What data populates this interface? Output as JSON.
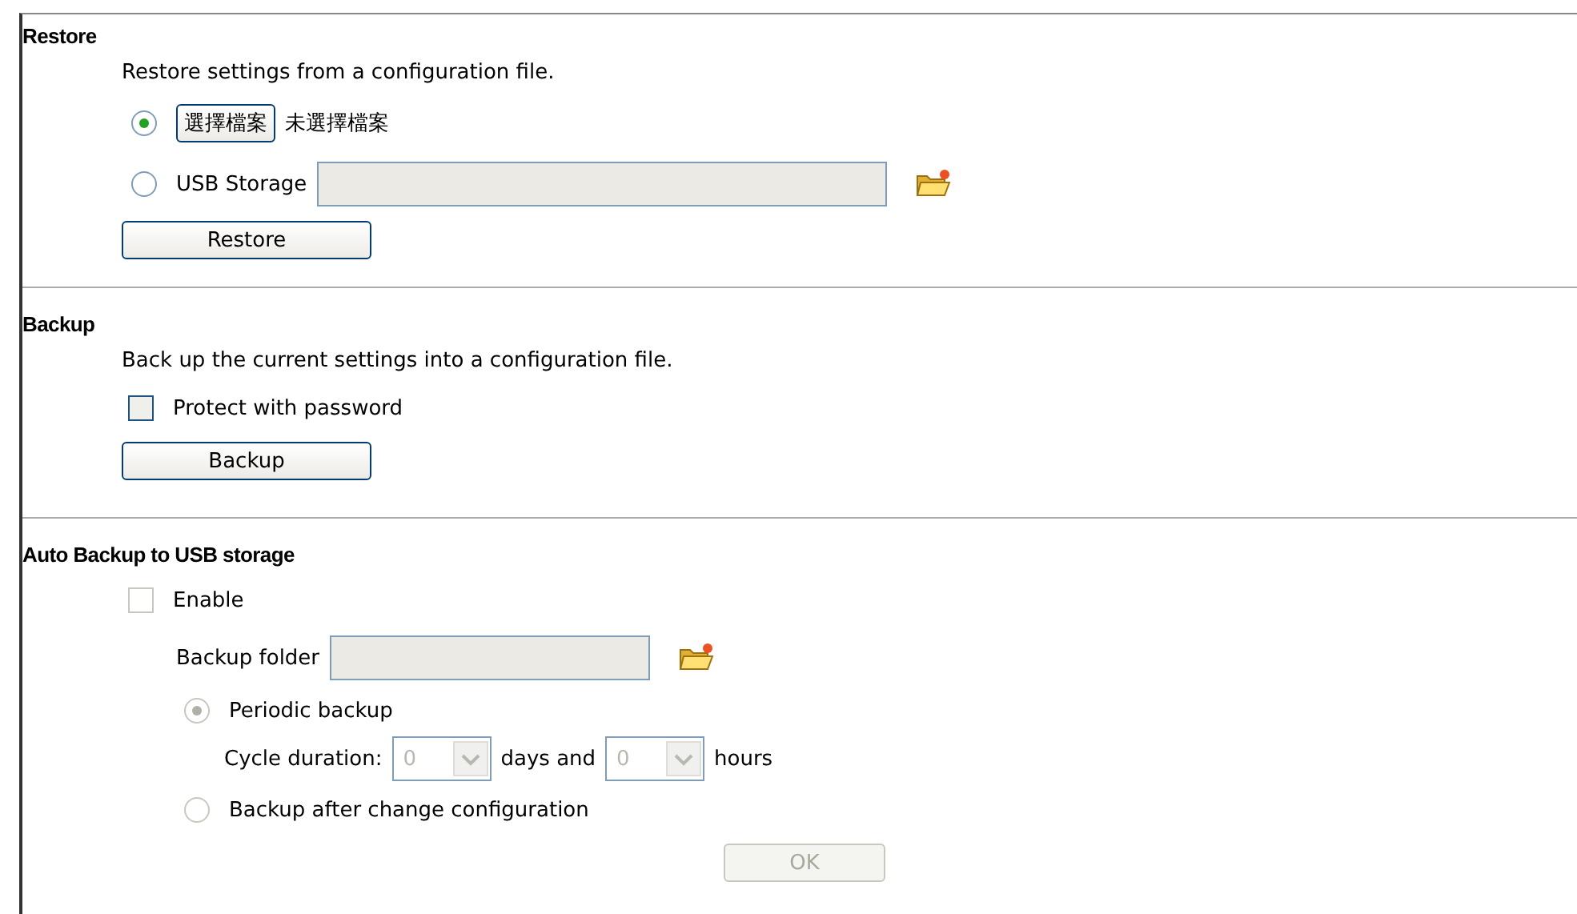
{
  "restore": {
    "heading": "Restore",
    "description": "Restore settings from a configuration file.",
    "options": [
      {
        "kind": "file",
        "selected": true,
        "button": "選擇檔案",
        "status": "未選擇檔案"
      },
      {
        "kind": "usb",
        "selected": false,
        "label": "USB Storage"
      }
    ],
    "button": "Restore"
  },
  "backup": {
    "heading": "Backup",
    "description": "Back up the current settings into a configuration file.",
    "protect": {
      "label": "Protect with password",
      "checked": false
    },
    "button": "Backup"
  },
  "auto_backup": {
    "heading": "Auto Backup to USB storage",
    "disabled": true,
    "enable": {
      "label": "Enable",
      "checked": false
    },
    "folder_label": "Backup folder",
    "modes": [
      {
        "kind": "periodic",
        "selected": true,
        "label": "Periodic backup",
        "cycle_label": "Cycle duration:",
        "days": "0",
        "days_label": "days and",
        "hours": "0",
        "hours_label": "hours"
      },
      {
        "kind": "change",
        "selected": false,
        "label": "Backup after change configuration"
      }
    ],
    "button": "OK"
  }
}
